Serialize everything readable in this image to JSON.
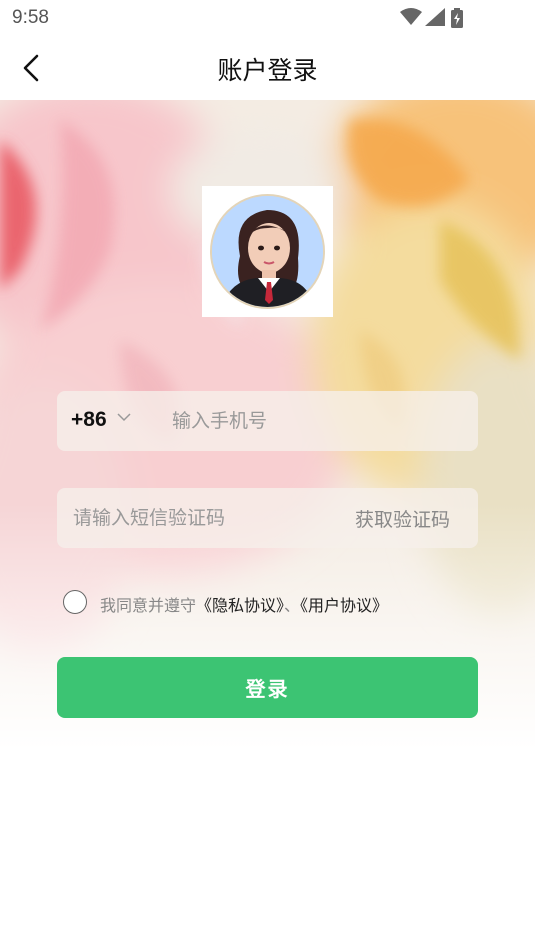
{
  "status_bar": {
    "time": "9:58"
  },
  "header": {
    "title": "账户登录"
  },
  "form": {
    "country_code": "+86",
    "phone_placeholder": "输入手机号",
    "code_placeholder": "请输入短信验证码",
    "get_code_label": "获取验证码"
  },
  "agreement": {
    "prefix": "我同意并遵守",
    "privacy_link": "《隐私协议》",
    "separator": "、",
    "user_link": "《用户协议》"
  },
  "login_button": {
    "label": "登录"
  },
  "colors": {
    "primary": "#3cc473"
  },
  "icons": [
    "back-arrow-icon",
    "wifi-icon",
    "signal-icon",
    "battery-icon",
    "chevron-down-icon"
  ]
}
